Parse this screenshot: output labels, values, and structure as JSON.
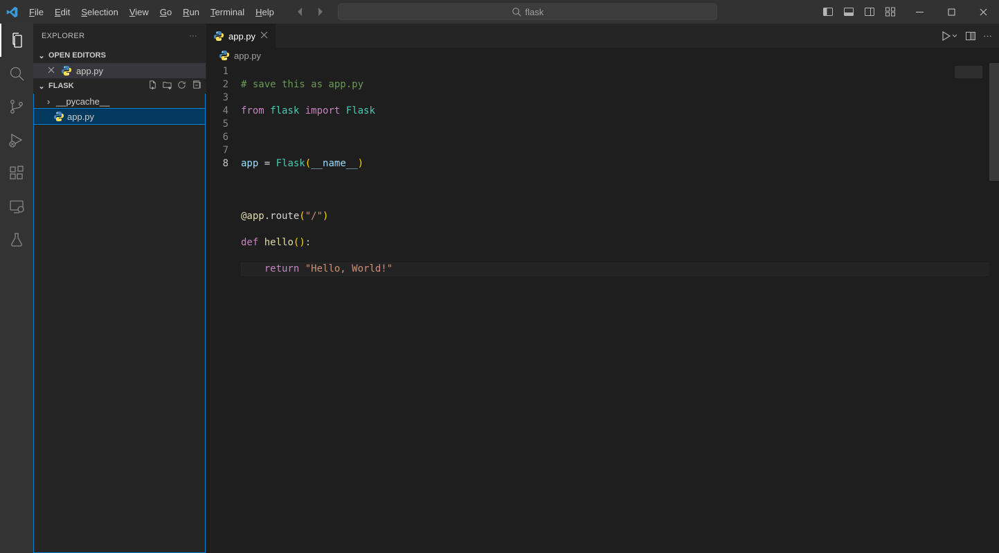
{
  "menu": {
    "file": "File",
    "edit": "Edit",
    "selection": "Selection",
    "view": "View",
    "go": "Go",
    "run": "Run",
    "terminal": "Terminal",
    "help": "Help"
  },
  "search_text": "flask",
  "sidebar": {
    "title": "EXPLORER",
    "open_editors": "OPEN EDITORS",
    "workspace": "FLASK",
    "open_tab": "app.py",
    "folder": "__pycache__",
    "file": "app.py"
  },
  "tab": {
    "name": "app.py"
  },
  "breadcrumb": {
    "file": "app.py"
  },
  "code": {
    "l1": "# save this as app.py",
    "l2_from": "from",
    "l2_flask": "flask",
    "l2_import": "import",
    "l2_Flask": "Flask",
    "l4_app": "app",
    "l4_eq": " = ",
    "l4_Flask": "Flask",
    "l4_name": "__name__",
    "l6_at": "@app",
    "l6_route": ".route",
    "l6_path": "\"/\"",
    "l7_def": "def",
    "l7_hello": "hello",
    "l8_return": "return",
    "l8_str": "\"Hello, World!\""
  },
  "line_numbers": [
    "1",
    "2",
    "3",
    "4",
    "5",
    "6",
    "7",
    "8"
  ],
  "current_line": 8
}
